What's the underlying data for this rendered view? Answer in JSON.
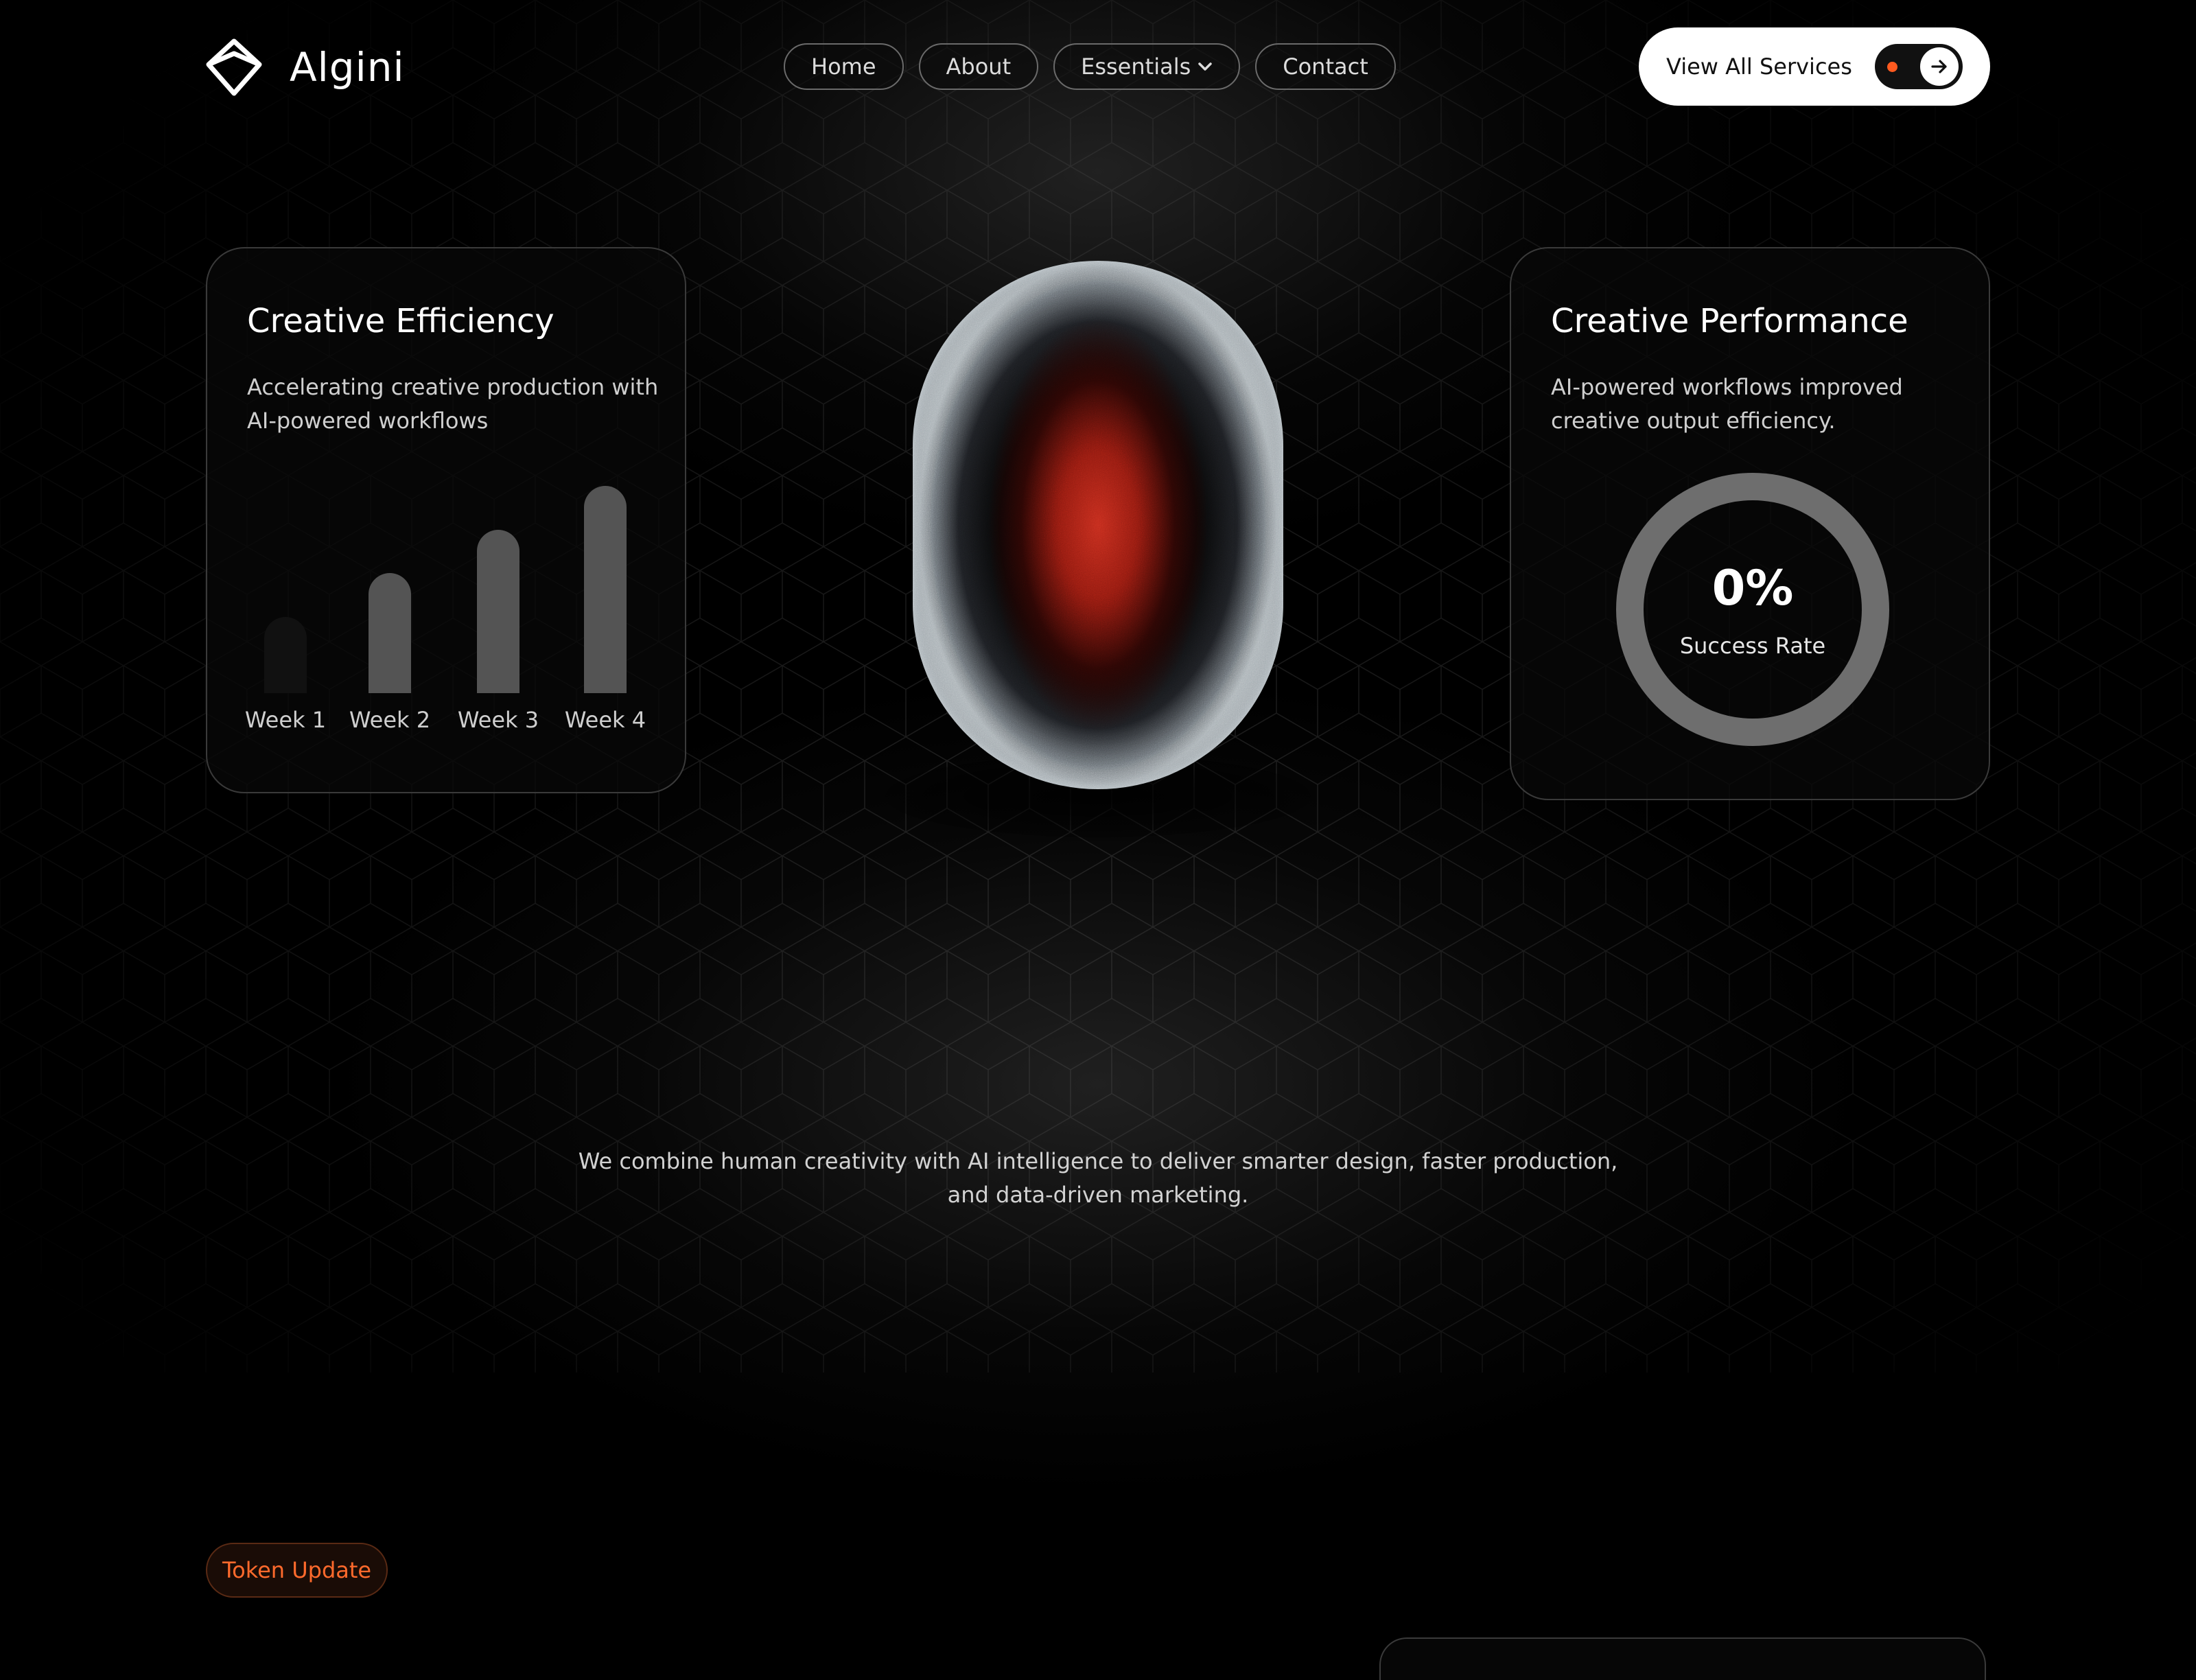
{
  "brand": {
    "name": "Algini",
    "logo_icon": "diamond-logo-icon"
  },
  "nav": {
    "items": [
      {
        "label": "Home"
      },
      {
        "label": "About"
      },
      {
        "label": "Essentials",
        "icon": "chevron-down-icon"
      },
      {
        "label": "Contact"
      }
    ]
  },
  "cta": {
    "label": "View All Services",
    "icon": "arrow-right-icon",
    "dot_color": "#ff5a1f"
  },
  "efficiency_card": {
    "title": "Creative Efficiency",
    "description": "Accelerating creative production with AI-powered workflows"
  },
  "performance_card": {
    "title": "Creative Performance",
    "description": "AI-powered workflows improved creative output efficiency.",
    "ring_value": "0%",
    "ring_label": "Success Rate",
    "progress": 0
  },
  "chart_data": {
    "type": "bar",
    "categories": [
      "Week 1",
      "Week 2",
      "Week 3",
      "Week 4"
    ],
    "values": [
      35,
      55,
      75,
      95
    ],
    "ylim": [
      0,
      100
    ],
    "colors": [
      "#111111",
      "#545454",
      "#545454",
      "#545454"
    ],
    "grid": false
  },
  "tagline": {
    "line1": "We combine human creativity with AI intelligence to deliver smarter design, faster production,",
    "line2": "and data-driven marketing."
  },
  "badge": {
    "label": "Token Update",
    "color": "#ff6a2c"
  }
}
